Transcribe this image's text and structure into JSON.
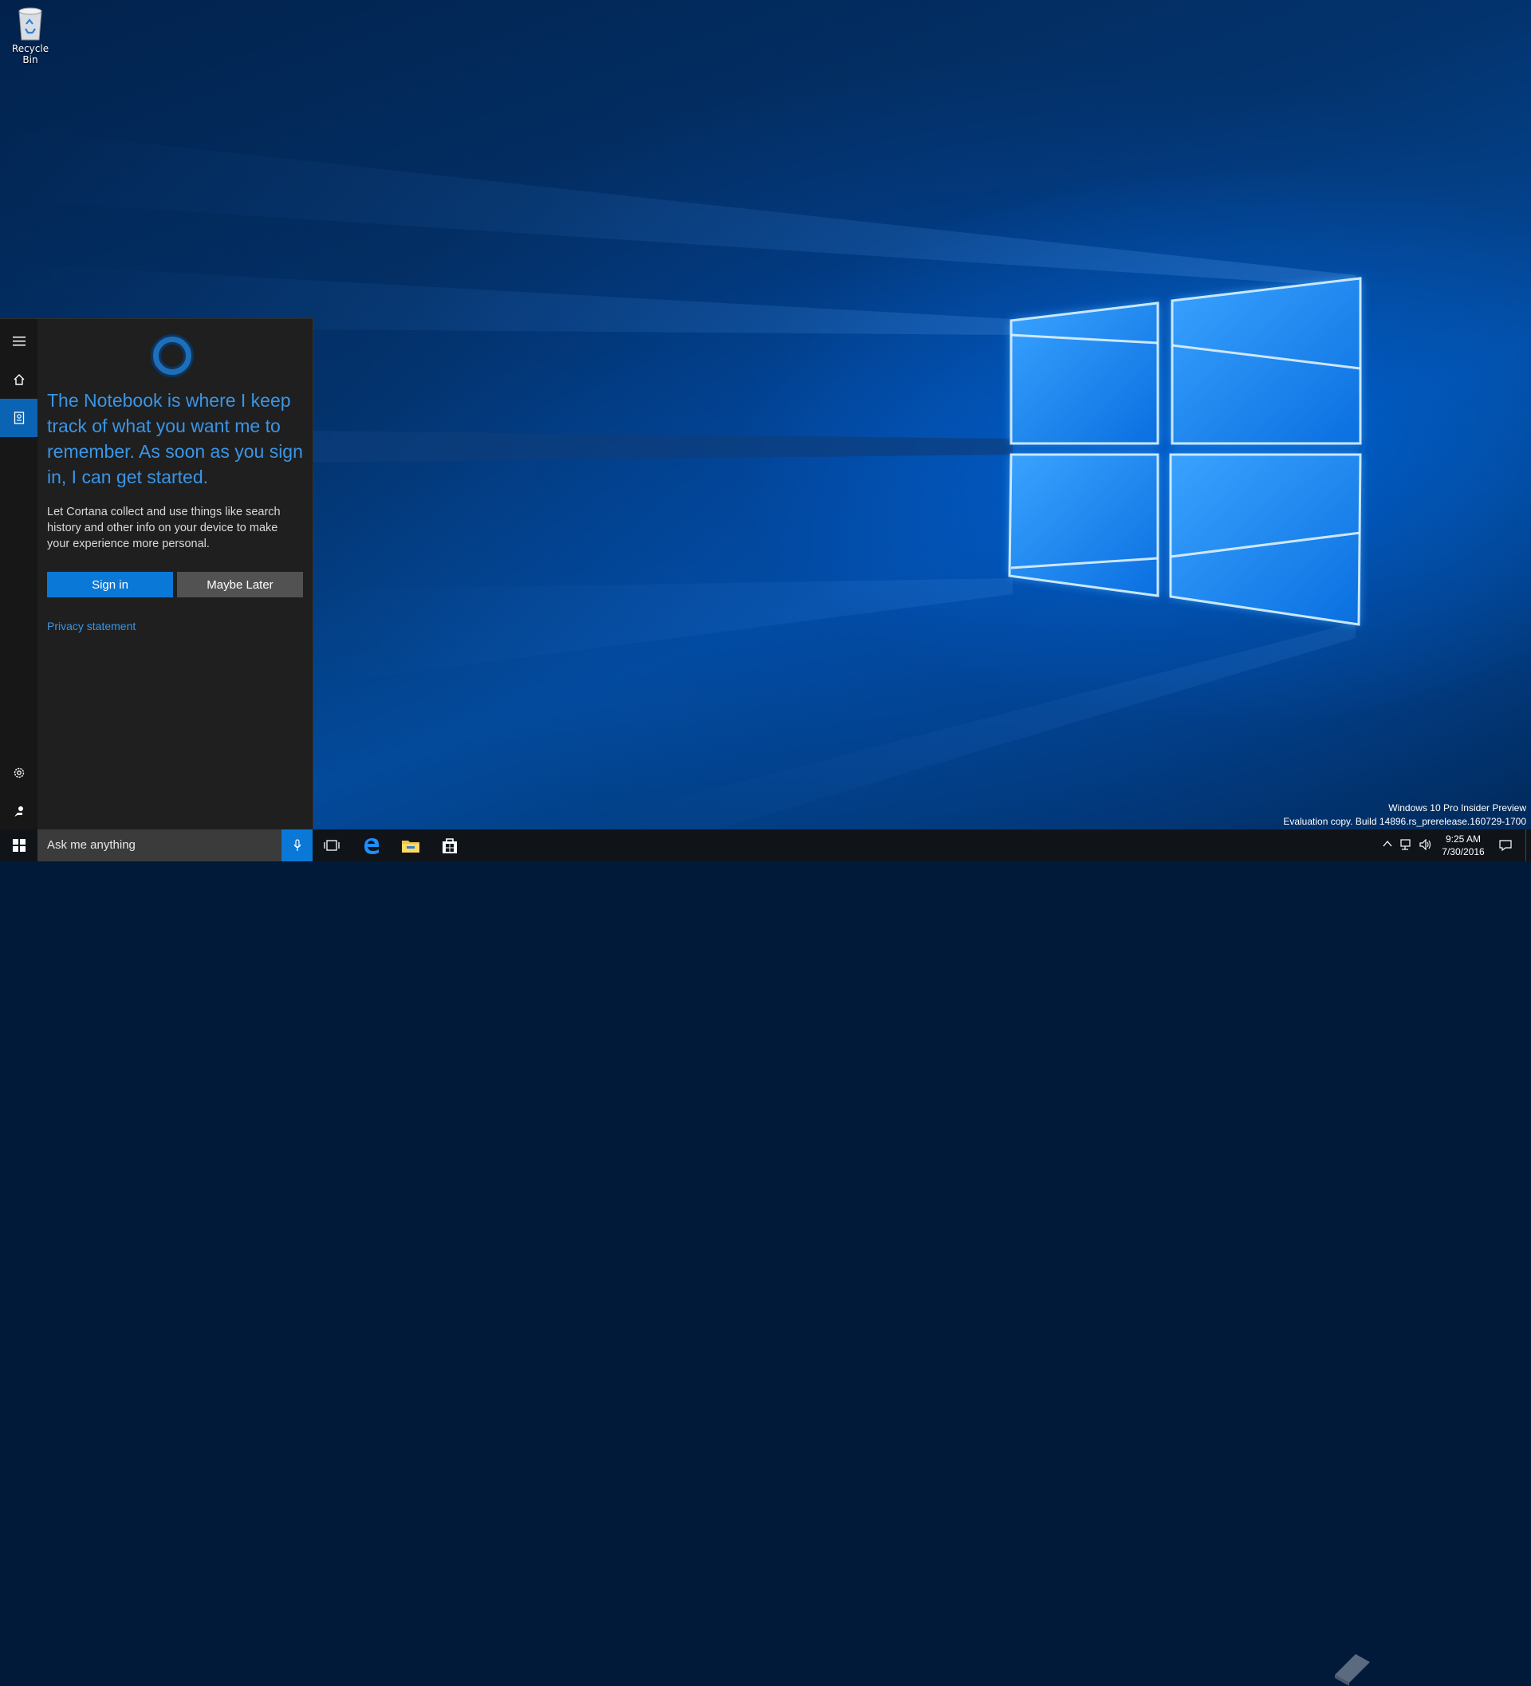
{
  "desktop": {
    "recycle_bin_label": "Recycle Bin"
  },
  "cortana": {
    "headline": "The Notebook is where I keep track of what you want me to remember. As soon as you sign in, I can get started.",
    "body": "Let Cortana collect and use things like search history and other info on your device to make your experience more personal.",
    "sign_in_label": "Sign in",
    "maybe_later_label": "Maybe Later",
    "privacy_label": "Privacy statement",
    "rail_icons": [
      "hamburger-menu-icon",
      "home-icon",
      "notebook-icon",
      "settings-icon",
      "feedback-icon"
    ],
    "active_item": "notebook"
  },
  "watermark": {
    "line1": "Windows 10 Pro Insider Preview",
    "line2": "Evaluation copy. Build 14896.rs_prerelease.160729-1700"
  },
  "taskbar": {
    "search_placeholder": "Ask me anything",
    "pinned": [
      "task-view-icon",
      "edge-icon",
      "file-explorer-icon",
      "store-icon"
    ],
    "time": "9:25 AM",
    "date": "7/30/2016"
  },
  "colors": {
    "accent": "#0a78d7",
    "cortana_text": "#3a95e6",
    "panel_bg": "#1f1f1f",
    "taskbar_bg": "#101419"
  }
}
